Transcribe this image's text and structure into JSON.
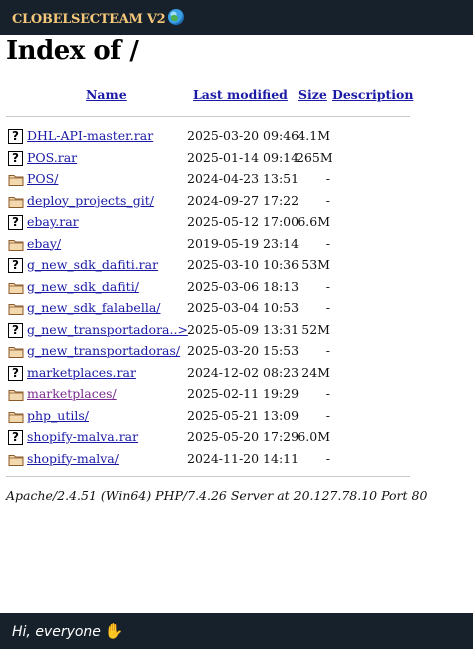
{
  "topbar": {
    "title": "CLOBELSECTEAM V2",
    "icon": "globe-icon"
  },
  "page": {
    "heading": "Index of /"
  },
  "columns": {
    "name": "Name",
    "modified": "Last modified",
    "size": "Size",
    "description": "Description"
  },
  "rows": [
    {
      "name": "DHL-API-master.rar",
      "date": "2025-03-20 09:46",
      "size": "4.1M",
      "type": "file"
    },
    {
      "name": "POS.rar",
      "date": "2025-01-14 09:14",
      "size": "265M",
      "type": "file"
    },
    {
      "name": "POS/",
      "date": "2024-04-23 13:51",
      "size": "-",
      "type": "folder"
    },
    {
      "name": "deploy_projects_git/",
      "date": "2024-09-27 17:22",
      "size": "-",
      "type": "folder"
    },
    {
      "name": "ebay.rar",
      "date": "2025-05-12 17:00",
      "size": "6.6M",
      "type": "file"
    },
    {
      "name": "ebay/",
      "date": "2019-05-19 23:14",
      "size": "-",
      "type": "folder"
    },
    {
      "name": "g_new_sdk_dafiti.rar",
      "date": "2025-03-10 10:36",
      "size": "53M",
      "type": "file"
    },
    {
      "name": "g_new_sdk_dafiti/",
      "date": "2025-03-06 18:13",
      "size": "-",
      "type": "folder"
    },
    {
      "name": "g_new_sdk_falabella/",
      "date": "2025-03-04 10:53",
      "size": "-",
      "type": "folder"
    },
    {
      "name": "g_new_transportadora..>",
      "date": "2025-05-09 13:31",
      "size": "52M",
      "type": "file"
    },
    {
      "name": "g_new_transportadoras/",
      "date": "2025-03-20 15:53",
      "size": "-",
      "type": "folder"
    },
    {
      "name": "marketplaces.rar",
      "date": "2024-12-02 08:23",
      "size": "24M",
      "type": "file"
    },
    {
      "name": "marketplaces/",
      "date": "2025-02-11 19:29",
      "size": "-",
      "type": "folder",
      "visited": true
    },
    {
      "name": "php_utils/",
      "date": "2025-05-21 13:09",
      "size": "-",
      "type": "folder"
    },
    {
      "name": "shopify-malva.rar",
      "date": "2025-05-20 17:29",
      "size": "6.0M",
      "type": "file"
    },
    {
      "name": "shopify-malva/",
      "date": "2024-11-20 14:11",
      "size": "-",
      "type": "folder"
    }
  ],
  "server_signature": "Apache/2.4.51 (Win64) PHP/7.4.26 Server at 20.127.78.10 Port 80",
  "bottombar": {
    "greeting": "Hi, everyone",
    "icon": "waving-hand-icon"
  },
  "colors": {
    "bar_bg": "#17212b",
    "title_gold": "#f4c77a",
    "link": "#1a1aa6",
    "visited": "#7a2b8f",
    "folder": "#d9a15a"
  }
}
